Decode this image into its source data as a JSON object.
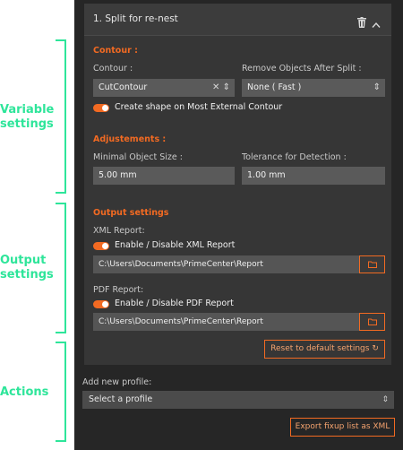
{
  "annotations": {
    "variable": "Variable settings",
    "output": "Output settings",
    "actions": "Actions"
  },
  "profile": {
    "title": "1. Split for re-nest",
    "icons": {
      "delete": "trash-icon",
      "collapse": "chevron-up-icon"
    }
  },
  "contour_section": {
    "title": "Contour :",
    "contour_label": "Contour :",
    "contour_value": "CutContour",
    "remove_label": "Remove Objects After Split :",
    "remove_value": "None ( Fast )",
    "toggle_label": "Create shape on Most External Contour"
  },
  "adjustments": {
    "title": "Adjustements :",
    "min_size_label": "Minimal Object Size :",
    "min_size_value": "5.00 mm",
    "tolerance_label": "Tolerance for Detection :",
    "tolerance_value": "1.00 mm"
  },
  "output": {
    "title": "Output settings",
    "xml_label": "XML Report:",
    "xml_toggle": "Enable / Disable XML Report",
    "xml_path": "C:\\Users\\Documents\\PrimeCenter\\Report",
    "pdf_label": "PDF Report:",
    "pdf_toggle": "Enable / Disable PDF Report",
    "pdf_path": "C:\\Users\\Documents\\PrimeCenter\\Report"
  },
  "reset_button": "Reset to default settings",
  "add_profile": {
    "label": "Add new profile:",
    "placeholder": "Select a profile"
  },
  "export_button": "Export fixup list as XML",
  "colors": {
    "accent": "#f26a22",
    "annotation": "#2ee59a",
    "panel": "#262626",
    "card": "#363636"
  }
}
